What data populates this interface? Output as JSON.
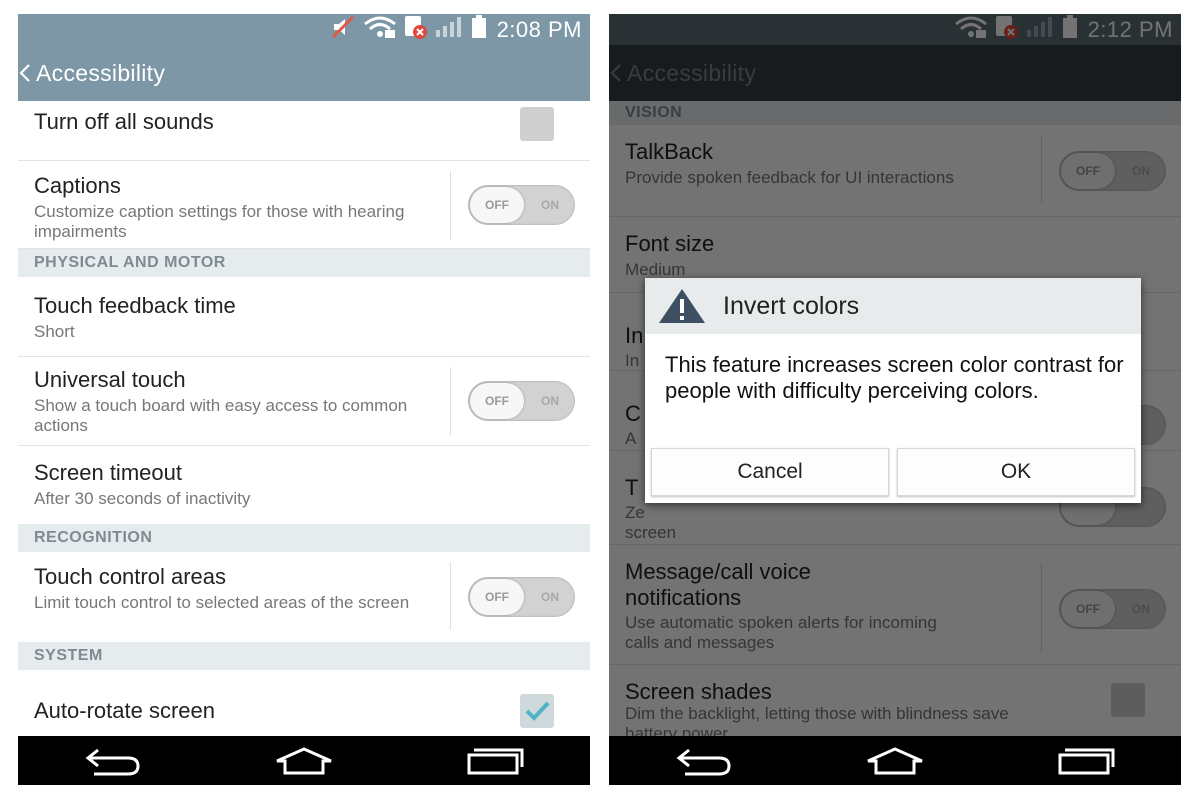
{
  "left": {
    "status": {
      "time": "2:08 PM"
    },
    "title": "Accessibility",
    "items": [
      {
        "title": "Turn off all sounds"
      },
      {
        "title": "Captions",
        "sub": "Customize caption settings for those with hearing impairments",
        "off": "OFF",
        "on": "ON"
      },
      {
        "section": "PHYSICAL AND MOTOR"
      },
      {
        "title": "Touch feedback time",
        "sub": "Short"
      },
      {
        "title": "Universal touch",
        "sub": "Show a touch board with easy access to common actions",
        "off": "OFF",
        "on": "ON"
      },
      {
        "title": "Screen timeout",
        "sub": "After 30 seconds of inactivity"
      },
      {
        "section": "RECOGNITION"
      },
      {
        "title": "Touch control areas",
        "sub": "Limit touch control to selected areas of the screen",
        "off": "OFF",
        "on": "ON"
      },
      {
        "section": "SYSTEM"
      },
      {
        "title": "Auto-rotate screen",
        "checked": true
      }
    ]
  },
  "right": {
    "status": {
      "time": "2:12 PM"
    },
    "title": "Accessibility",
    "items": [
      {
        "section": "VISION"
      },
      {
        "title": "TalkBack",
        "sub": "Provide spoken feedback for UI interactions",
        "off": "OFF",
        "on": "ON"
      },
      {
        "title": "Font size",
        "sub": "Medium"
      },
      {
        "title": "In",
        "sub": "In"
      },
      {
        "title": "C",
        "sub": "A"
      },
      {
        "title": "T",
        "sub": "Ze",
        "sub2": "screen"
      },
      {
        "title": "Message/call voice notifications",
        "sub": "Use automatic spoken alerts for incoming calls and messages",
        "off": "OFF",
        "on": "ON"
      },
      {
        "title": "Screen shades",
        "sub": "Dim the backlight, letting those with blindness save battery power"
      }
    ],
    "dialog": {
      "title": "Invert colors",
      "body": "This feature increases screen color contrast for people with difficulty perceiving colors.",
      "cancel": "Cancel",
      "ok": "OK"
    }
  },
  "colors": {
    "header": "#7d97a6",
    "section": "#e6ebed",
    "checkAccent": "#4fb3c8"
  },
  "icons": [
    "mute-icon",
    "wifi-icon",
    "sim-error-icon",
    "signal-icon",
    "battery-icon",
    "back-chevron-icon",
    "back-icon",
    "home-icon",
    "recent-apps-icon",
    "warning-icon"
  ]
}
